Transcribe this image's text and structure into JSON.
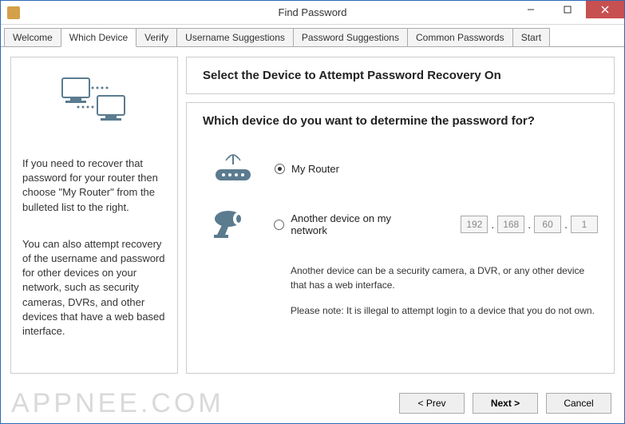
{
  "window": {
    "title": "Find Password"
  },
  "tabs": [
    "Welcome",
    "Which Device",
    "Verify",
    "Username Suggestions",
    "Password Suggestions",
    "Common Passwords",
    "Start"
  ],
  "activeTab": 1,
  "leftPanel": {
    "para1": "If you need to recover that password for your router then choose \"My Router\" from the bulleted list to the right.",
    "para2": "You can also attempt recovery of the username and password for other devices on your network, such as security cameras, DVRs, and other devices that have a web based interface."
  },
  "mainTitle": "Select the Device to Attempt Password Recovery On",
  "question": "Which device do you want to determine the password for?",
  "options": {
    "router": {
      "label": "My Router",
      "checked": true
    },
    "other": {
      "label": "Another device on my network",
      "checked": false
    }
  },
  "ip": [
    "192",
    "168",
    "60",
    "1"
  ],
  "notes": {
    "p1": "Another device can be a security camera, a DVR, or any other device that has a web interface.",
    "p2": "Please note: It is illegal to attempt login to a device that you do not own."
  },
  "buttons": {
    "prev": "< Prev",
    "next": "Next >",
    "cancel": "Cancel"
  },
  "watermark": "APPNEE.COM"
}
